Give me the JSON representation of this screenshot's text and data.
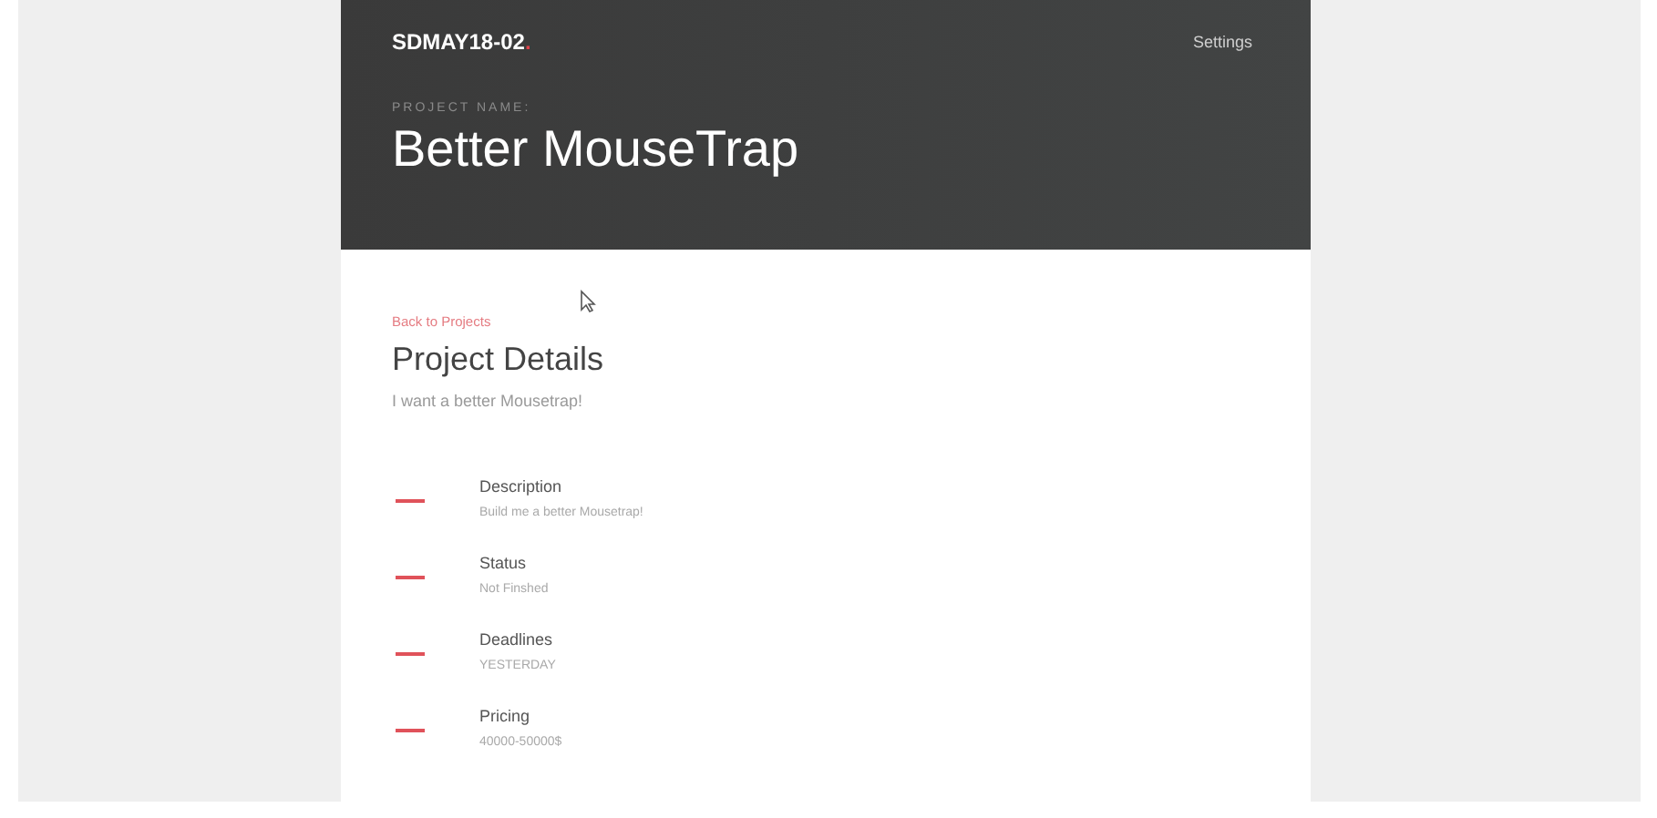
{
  "header": {
    "logo": "SDMAY18-02",
    "logo_mark": ".",
    "settings_link": "Settings",
    "project_label": "PROJECT NAME:",
    "project_name": "Better MouseTrap"
  },
  "content": {
    "back_link": "Back to Projects",
    "title": "Project Details",
    "subtitle": "I want a better Mousetrap!"
  },
  "details": [
    {
      "label": "Description",
      "value": "Build me a better Mousetrap!"
    },
    {
      "label": "Status",
      "value": "Not Finshed"
    },
    {
      "label": "Deadlines",
      "value": "YESTERDAY"
    },
    {
      "label": "Pricing",
      "value": "40000-50000$"
    }
  ]
}
